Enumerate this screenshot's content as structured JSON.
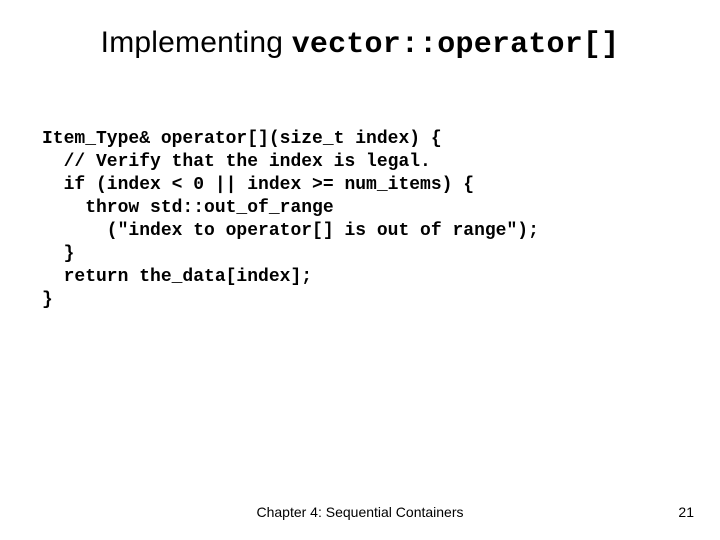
{
  "title": {
    "plain": "Implementing ",
    "code": "vector::operator[]"
  },
  "code": {
    "l1": "Item_Type& operator[](size_t index) {",
    "l2": "  // Verify that the index is legal.",
    "l3": "  if (index < 0 || index >= num_items) {",
    "l4": "    throw std::out_of_range",
    "l5": "      (\"index to operator[] is out of range\");",
    "l6": "  }",
    "l7": "  return the_data[index];",
    "l8": "}"
  },
  "footer": {
    "center": "Chapter 4: Sequential Containers",
    "page": "21"
  }
}
